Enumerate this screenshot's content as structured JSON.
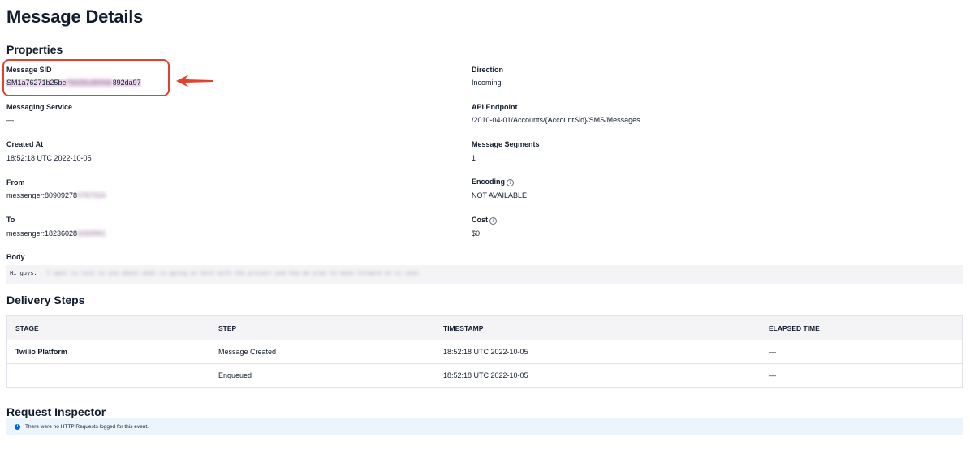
{
  "page": {
    "title": "Message Details"
  },
  "properties": {
    "title": "Properties",
    "message_sid": {
      "label": "Message SID",
      "prefix": "SM1a76271b25be",
      "redacted": "7bb2bcd6f4de",
      "suffix": "892da97"
    },
    "direction": {
      "label": "Direction",
      "value": "Incoming"
    },
    "messaging_service": {
      "label": "Messaging Service",
      "value": "—"
    },
    "api_endpoint": {
      "label": "API Endpoint",
      "value": "/2010-04-01/Accounts/{AccountSid}/SMS/Messages"
    },
    "created_at": {
      "label": "Created At",
      "value": "18:52:18 UTC 2022-10-05"
    },
    "message_segments": {
      "label": "Message Segments",
      "value": "1"
    },
    "from": {
      "label": "From",
      "value": "messenger:80909278",
      "redacted": "0767024"
    },
    "encoding": {
      "label": "Encoding",
      "value": "NOT AVAILABLE"
    },
    "to": {
      "label": "To",
      "value": "messenger:18236028",
      "redacted": "6069991"
    },
    "cost": {
      "label": "Cost",
      "value": "$0"
    },
    "body": {
      "label": "Body",
      "value": "Hi guys.",
      "redacted": "I want to talk to you about what is going on here with the project and how we plan to move forward on it soon"
    }
  },
  "delivery_steps": {
    "title": "Delivery Steps",
    "columns": [
      "STAGE",
      "STEP",
      "TIMESTAMP",
      "ELAPSED TIME"
    ],
    "rows": [
      {
        "stage": "Twilio Platform",
        "step": "Message Created",
        "timestamp": "18:52:18 UTC 2022-10-05",
        "elapsed": "—"
      },
      {
        "stage": "",
        "step": "Enqueued",
        "timestamp": "18:52:18 UTC 2022-10-05",
        "elapsed": "—"
      }
    ]
  },
  "request_inspector": {
    "title": "Request Inspector",
    "notice": "There were no HTTP Requests logged for this event."
  },
  "colors": {
    "annotation": "#e2412b",
    "notice_bg": "#ecf5fc",
    "info_blue": "#0263e0",
    "text": "#121c2d"
  },
  "icons": {
    "info": "info-circle-icon",
    "annotation": "arrow-left-icon"
  }
}
